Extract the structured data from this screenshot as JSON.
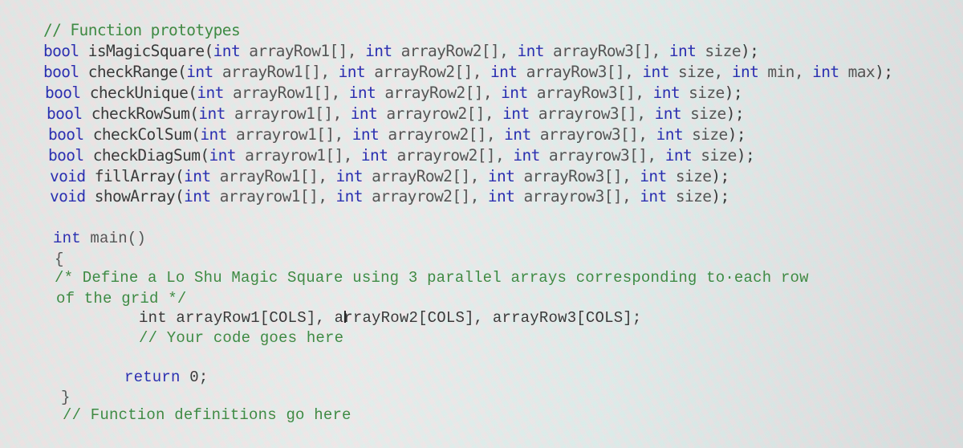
{
  "editor": {
    "prototypes_comment": "// Function prototypes",
    "prototypes": [
      {
        "ret": "bool",
        "name": "isMagicSquare",
        "params": [
          [
            "int",
            "arrayRow1[]"
          ],
          [
            "int",
            "arrayRow2[]"
          ],
          [
            "int",
            "arrayRow3[]"
          ],
          [
            "int",
            "size"
          ]
        ]
      },
      {
        "ret": "bool",
        "name": "checkRange",
        "params": [
          [
            "int",
            "arrayRow1[]"
          ],
          [
            "int",
            "arrayRow2[]"
          ],
          [
            "int",
            "arrayRow3[]"
          ],
          [
            "int",
            "size"
          ],
          [
            "int",
            "min"
          ],
          [
            "int",
            "max"
          ]
        ]
      },
      {
        "ret": "bool",
        "name": "checkUnique",
        "params": [
          [
            "int",
            "arrayRow1[]"
          ],
          [
            "int",
            "arrayRow2[]"
          ],
          [
            "int",
            "arrayRow3[]"
          ],
          [
            "int",
            "size"
          ]
        ]
      },
      {
        "ret": "bool",
        "name": "checkRowSum",
        "params": [
          [
            "int",
            "arrayrow1[]"
          ],
          [
            "int",
            "arrayrow2[]"
          ],
          [
            "int",
            "arrayrow3[]"
          ],
          [
            "int",
            "size"
          ]
        ]
      },
      {
        "ret": "bool",
        "name": "checkColSum",
        "params": [
          [
            "int",
            "arrayrow1[]"
          ],
          [
            "int",
            "arrayrow2[]"
          ],
          [
            "int",
            "arrayrow3[]"
          ],
          [
            "int",
            "size"
          ]
        ]
      },
      {
        "ret": "bool",
        "name": "checkDiagSum",
        "params": [
          [
            "int",
            "arrayrow1[]"
          ],
          [
            "int",
            "arrayrow2[]"
          ],
          [
            "int",
            "arrayrow3[]"
          ],
          [
            "int",
            "size"
          ]
        ]
      },
      {
        "ret": "void",
        "name": "fillArray",
        "params": [
          [
            "int",
            "arrayRow1[]"
          ],
          [
            "int",
            "arrayRow2[]"
          ],
          [
            "int",
            "arrayRow3[]"
          ],
          [
            "int",
            "size"
          ]
        ]
      },
      {
        "ret": "void",
        "name": "showArray",
        "params": [
          [
            "int",
            "arrayrow1[]"
          ],
          [
            "int",
            "arrayrow2[]"
          ],
          [
            "int",
            "arrayrow3[]"
          ],
          [
            "int",
            "size"
          ]
        ]
      }
    ],
    "main": {
      "signature_kw": "int",
      "signature_rest": " main()",
      "open_brace": "{",
      "comment_line1": "/* Define a Lo Shu Magic Square using 3 parallel arrays corresponding to·each row",
      "comment_line2": "of the grid */",
      "decl_kw": "int",
      "decl_rest": " arrayRow1[COLS], arrayRow2[COLS], arrayRow3[COLS];",
      "code_comment": "// Your code goes here",
      "return_kw": "return",
      "return_rest": " 0;",
      "close_brace": "}",
      "definitions_comment": "// Function definitions go here"
    }
  }
}
